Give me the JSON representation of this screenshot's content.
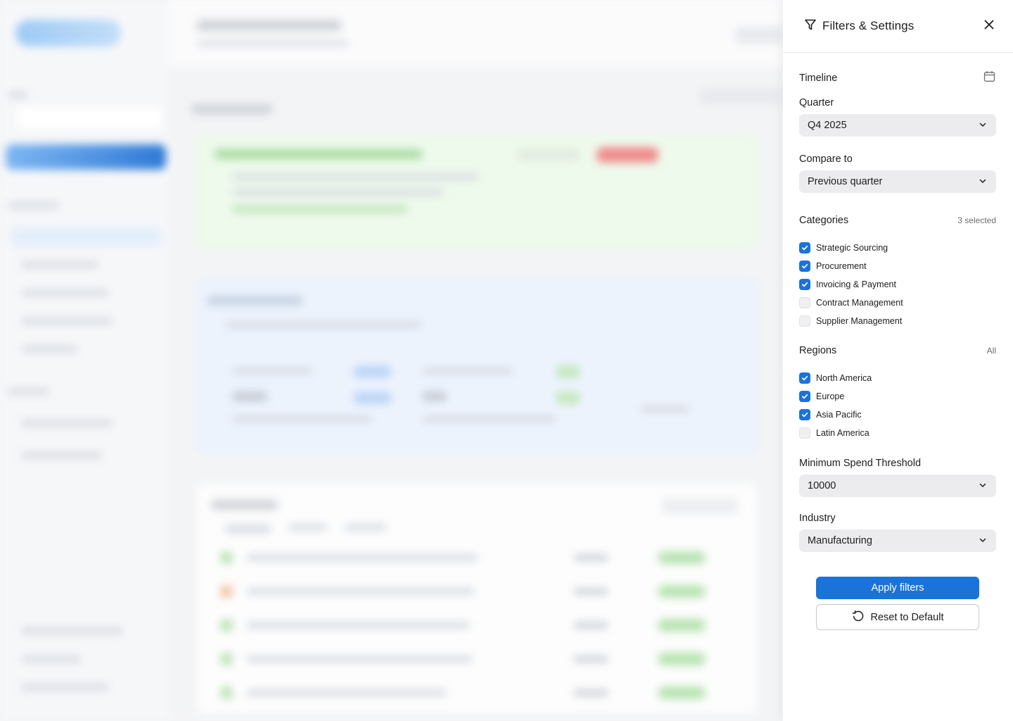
{
  "panel": {
    "title": "Filters & Settings",
    "timeline": {
      "label": "Timeline"
    },
    "quarter": {
      "label": "Quarter",
      "value": "Q4 2025"
    },
    "compare": {
      "label": "Compare to",
      "value": "Previous quarter"
    },
    "categories": {
      "label": "Categories",
      "note": "3 selected",
      "items": [
        {
          "label": "Strategic Sourcing",
          "checked": true
        },
        {
          "label": "Procurement",
          "checked": true
        },
        {
          "label": "Invoicing & Payment",
          "checked": true
        },
        {
          "label": "Contract Management",
          "checked": false
        },
        {
          "label": "Supplier Management",
          "checked": false
        }
      ]
    },
    "regions": {
      "label": "Regions",
      "note": "All",
      "items": [
        {
          "label": "North America",
          "checked": true
        },
        {
          "label": "Europe",
          "checked": true
        },
        {
          "label": "Asia Pacific",
          "checked": true
        },
        {
          "label": "Latin America",
          "checked": false
        }
      ]
    },
    "spend": {
      "label": "Minimum Spend Threshold",
      "value": "10000"
    },
    "industry": {
      "label": "Industry",
      "value": "Manufacturing"
    },
    "apply_label": "Apply filters",
    "reset_label": "Reset to Default"
  },
  "colors": {
    "accent": "#1a73d9",
    "panel_bg": "#ffffff",
    "select_bg": "#ececee"
  },
  "icons": [
    "filter-icon",
    "close-icon",
    "calendar-icon",
    "chevron-down-icon",
    "check-icon",
    "reset-icon"
  ]
}
